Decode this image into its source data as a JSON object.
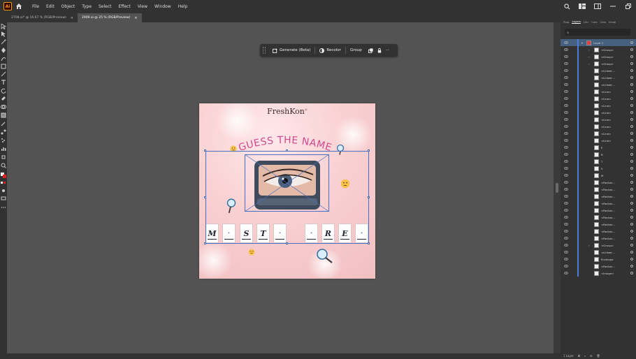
{
  "app": {
    "logo_text": "Ai"
  },
  "menu": [
    "File",
    "Edit",
    "Object",
    "Type",
    "Select",
    "Effect",
    "View",
    "Window",
    "Help"
  ],
  "tabs": [
    {
      "label": "2708.ai* @ 16.67 % (RGB/Preview)",
      "close": "×"
    },
    {
      "label": "2909.ai @ 25 % (RGB/Preview)",
      "close": "×"
    }
  ],
  "context_bar": {
    "generate": "Generate (Beta)",
    "recolor": "Recolor",
    "group": "Group",
    "more": "···"
  },
  "artboard": {
    "brand": "FreshKon",
    "brand_mark": "®",
    "headline": "GUESS THE NAME",
    "tiles": [
      "M",
      "•",
      "S",
      "T",
      "•",
      "•",
      "R",
      "E",
      "•"
    ]
  },
  "panel": {
    "tabs": [
      "Prop",
      "Layers",
      "Libr",
      "Colo",
      "Colo",
      "Gradi"
    ],
    "active_tab": "Layers",
    "search_placeholder": "Q",
    "layers": [
      {
        "name": "Layer 1",
        "level": 0
      },
      {
        "name": "<Group>",
        "level": 2
      },
      {
        "name": "<Group>",
        "level": 2
      },
      {
        "name": "<Group>",
        "level": 2
      },
      {
        "name": "<Linked ...",
        "level": 1
      },
      {
        "name": "<Linked ...",
        "level": 1
      },
      {
        "name": "<Linked ...",
        "level": 1
      },
      {
        "name": "<Line>",
        "level": 1
      },
      {
        "name": "<Line>",
        "level": 1
      },
      {
        "name": "<Line>",
        "level": 1
      },
      {
        "name": "<Line>",
        "level": 1
      },
      {
        "name": "<Line>",
        "level": 1
      },
      {
        "name": "<Line>",
        "level": 1
      },
      {
        "name": "<Line>",
        "level": 1
      },
      {
        "name": "<Line>",
        "level": 1
      },
      {
        "name": "E",
        "level": 1
      },
      {
        "name": "R",
        "level": 1
      },
      {
        "name": "T",
        "level": 1
      },
      {
        "name": "S",
        "level": 1
      },
      {
        "name": "M",
        "level": 1
      },
      {
        "name": "<Rectan...",
        "level": 1
      },
      {
        "name": "<Rectan...",
        "level": 1
      },
      {
        "name": "<Rectan...",
        "level": 1
      },
      {
        "name": "<Rectan...",
        "level": 1
      },
      {
        "name": "<Rectan...",
        "level": 1
      },
      {
        "name": "<Rectan...",
        "level": 1
      },
      {
        "name": "<Rectan...",
        "level": 1
      },
      {
        "name": "<Rectan...",
        "level": 1
      },
      {
        "name": "<Rectan...",
        "level": 1
      },
      {
        "name": "<Group>",
        "level": 2
      },
      {
        "name": "<Linked ...",
        "level": 1
      },
      {
        "name": "Envelope",
        "level": 1
      },
      {
        "name": "<Rectan...",
        "level": 1
      },
      {
        "name": "<Image>",
        "level": 1
      }
    ],
    "footer": "1 Layer"
  },
  "colors": {
    "ui_dark": "#323232",
    "canvas": "#535353",
    "accent_blue": "#4b7bd6",
    "headline_pink": "#d14a8e",
    "artboard_pink": "#f9d0d2"
  }
}
